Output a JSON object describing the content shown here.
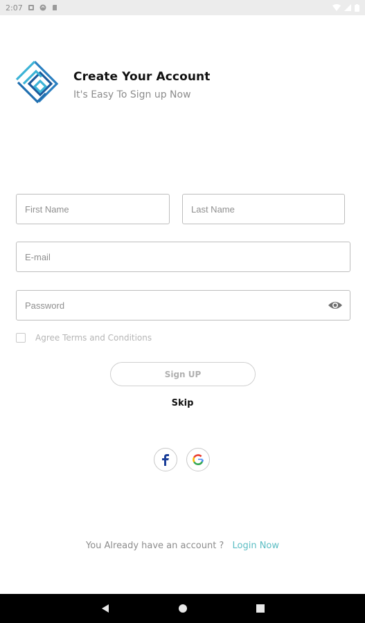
{
  "status_bar": {
    "time": "2:07"
  },
  "header": {
    "title": "Create Your Account",
    "subtitle": "It's Easy To Sign up Now"
  },
  "form": {
    "first_name": {
      "placeholder": "First Name",
      "value": ""
    },
    "last_name": {
      "placeholder": "Last Name",
      "value": ""
    },
    "email": {
      "placeholder": "E-mail",
      "value": ""
    },
    "password": {
      "placeholder": "Password",
      "value": ""
    },
    "agree_label": "Agree Terms and Conditions",
    "agree_checked": false
  },
  "actions": {
    "signup_label": "Sign UP",
    "skip_label": "Skip"
  },
  "social": {
    "facebook_icon": "facebook-icon",
    "google_icon": "google-icon"
  },
  "footer": {
    "question": "You Already have an account ?",
    "login_link": "Login Now"
  },
  "colors": {
    "accent": "#5bbdc3",
    "logo_dark": "#1b5a9c",
    "logo_light": "#3bb3d6"
  },
  "navigation": {
    "back_icon": "back-triangle-icon",
    "home_icon": "home-circle-icon",
    "recents_icon": "recents-square-icon"
  }
}
